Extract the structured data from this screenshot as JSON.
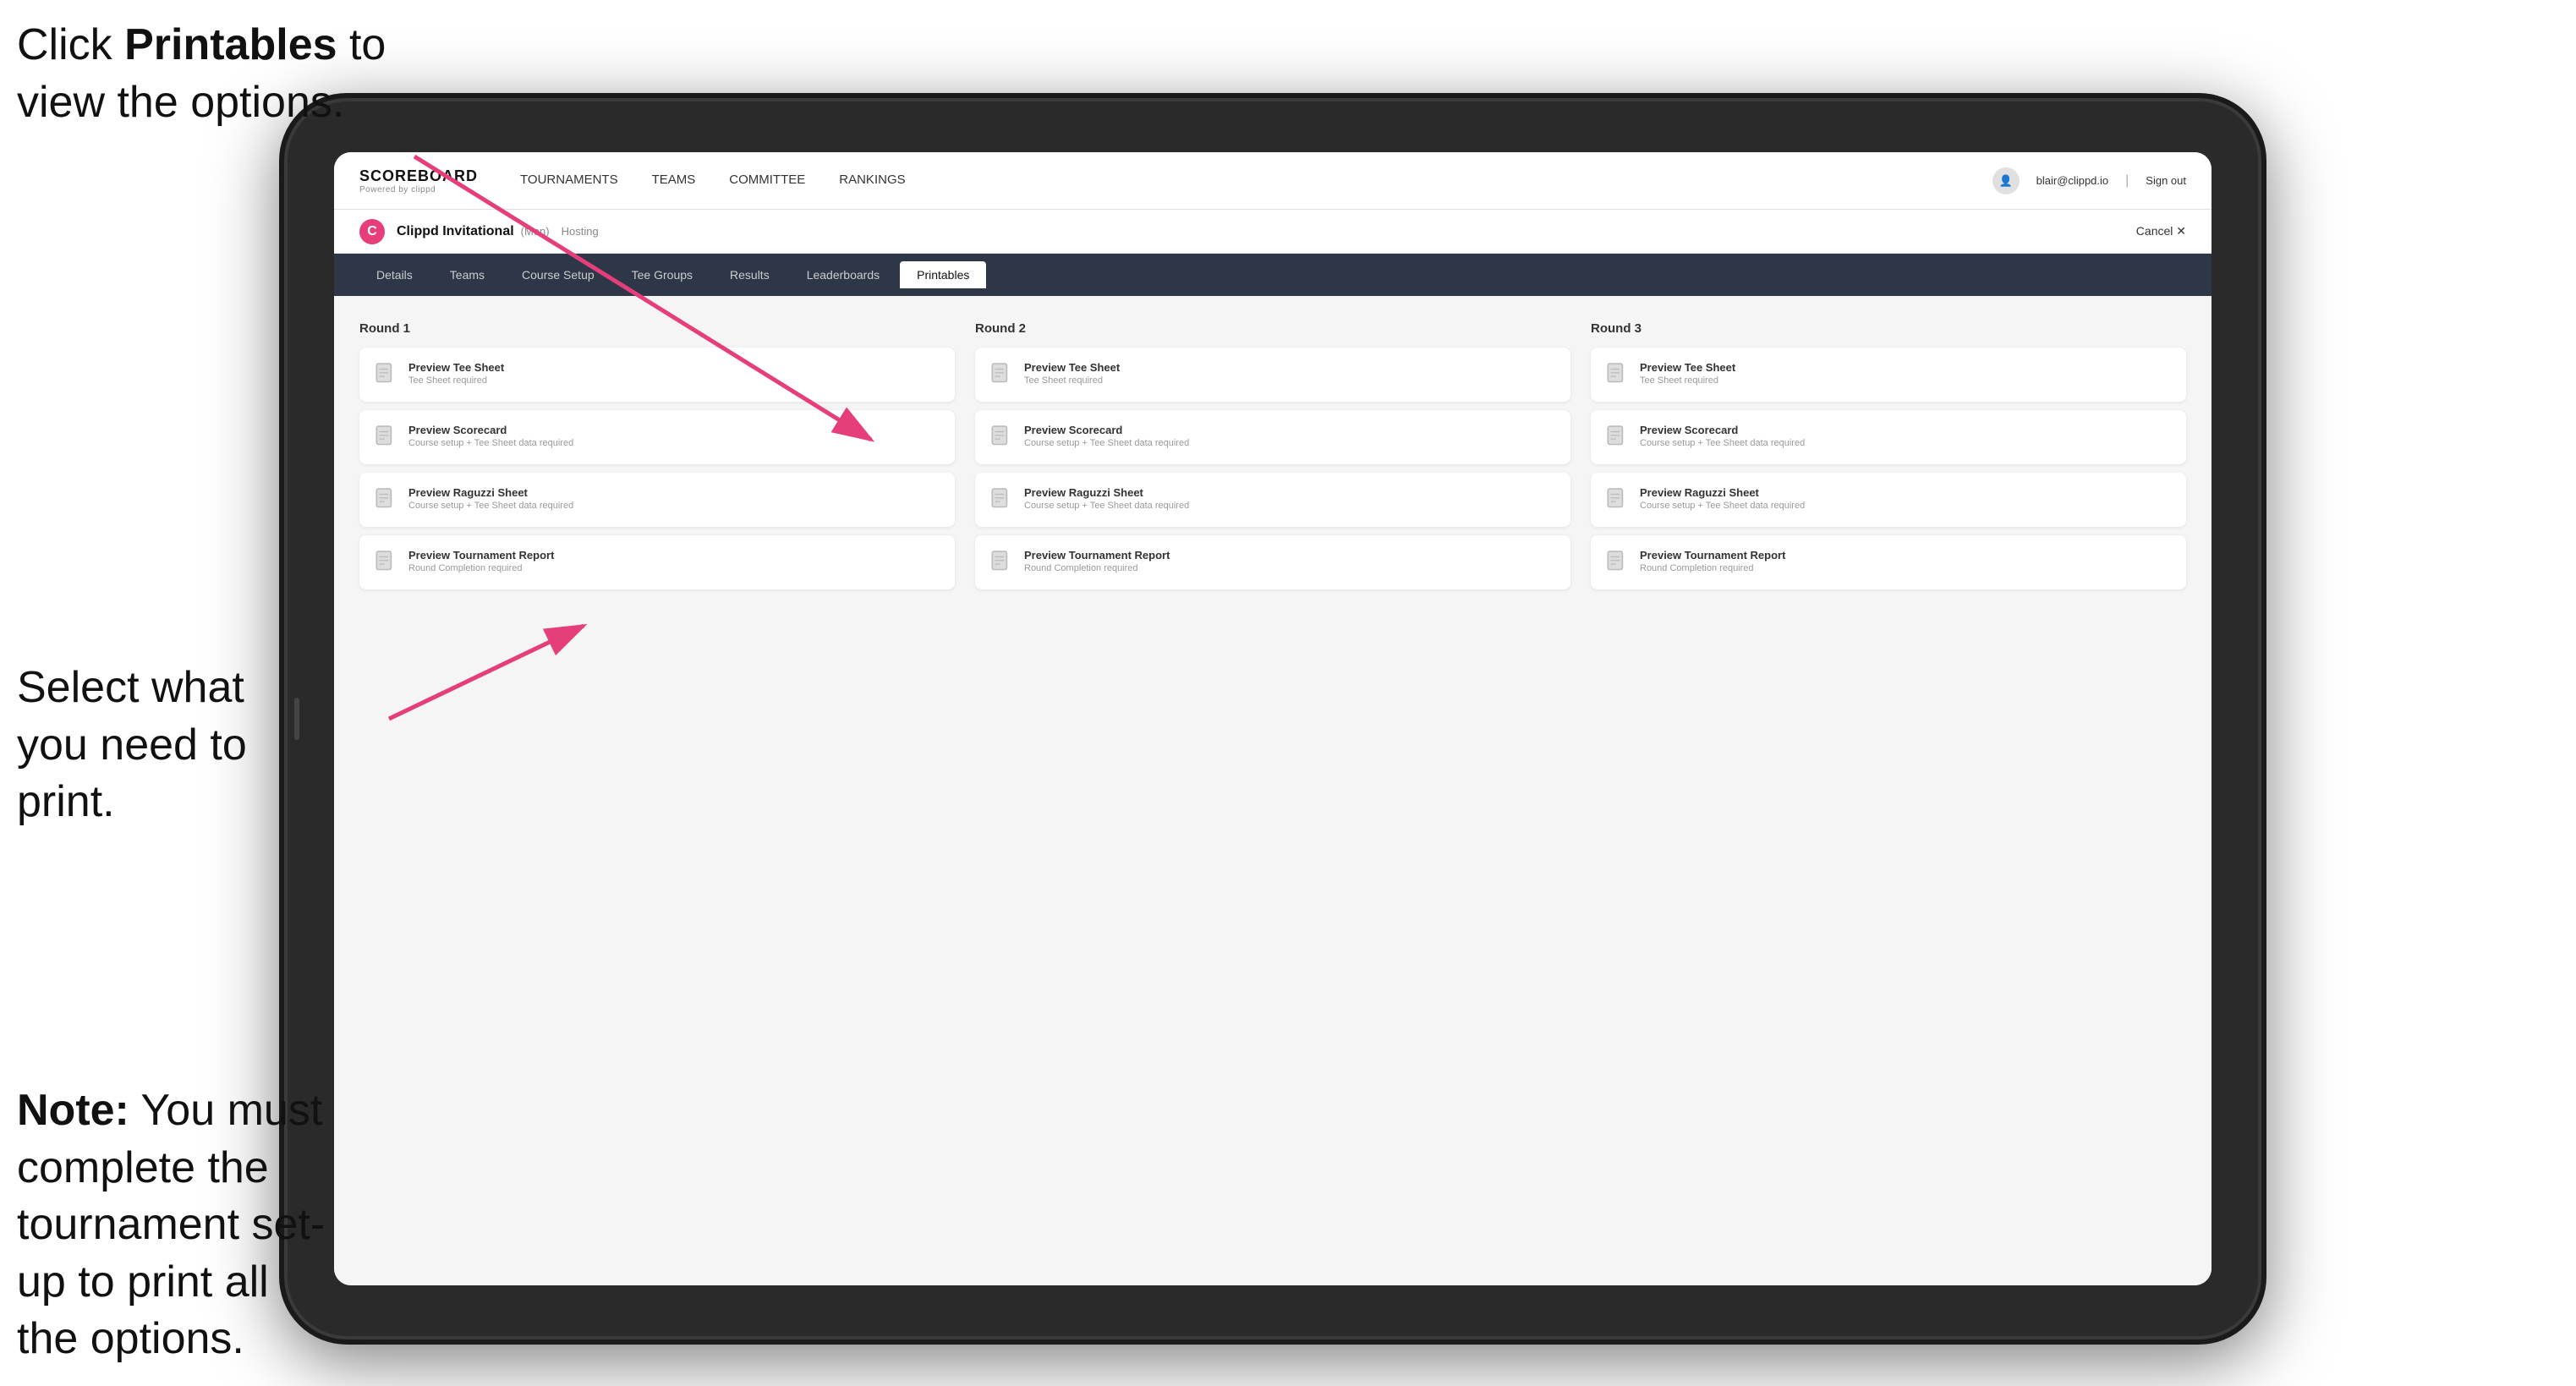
{
  "annotations": {
    "top": {
      "line1": "Click ",
      "bold": "Printables",
      "line2": " to",
      "line3": "view the options."
    },
    "middle": {
      "text": "Select what you need to print."
    },
    "bottom": {
      "bold": "Note:",
      "text": " You must complete the tournament set-up to print all the options."
    }
  },
  "topNav": {
    "logoTitle": "SCOREBOARD",
    "logoSub": "Powered by clippd",
    "links": [
      {
        "label": "TOURNAMENTS",
        "active": false
      },
      {
        "label": "TEAMS",
        "active": false
      },
      {
        "label": "COMMITTEE",
        "active": false
      },
      {
        "label": "RANKINGS",
        "active": false
      }
    ],
    "userEmail": "blair@clippd.io",
    "signOut": "Sign out"
  },
  "subHeader": {
    "logoChar": "C",
    "tournamentName": "Clippd Invitational",
    "division": "(Men)",
    "status": "Hosting",
    "cancel": "Cancel ✕"
  },
  "tabs": [
    {
      "label": "Details",
      "active": false
    },
    {
      "label": "Teams",
      "active": false
    },
    {
      "label": "Course Setup",
      "active": false
    },
    {
      "label": "Tee Groups",
      "active": false
    },
    {
      "label": "Results",
      "active": false
    },
    {
      "label": "Leaderboards",
      "active": false
    },
    {
      "label": "Printables",
      "active": true
    }
  ],
  "rounds": [
    {
      "title": "Round 1",
      "cards": [
        {
          "title": "Preview Tee Sheet",
          "sub": "Tee Sheet required"
        },
        {
          "title": "Preview Scorecard",
          "sub": "Course setup + Tee Sheet data required"
        },
        {
          "title": "Preview Raguzzi Sheet",
          "sub": "Course setup + Tee Sheet data required"
        },
        {
          "title": "Preview Tournament Report",
          "sub": "Round Completion required"
        }
      ]
    },
    {
      "title": "Round 2",
      "cards": [
        {
          "title": "Preview Tee Sheet",
          "sub": "Tee Sheet required"
        },
        {
          "title": "Preview Scorecard",
          "sub": "Course setup + Tee Sheet data required"
        },
        {
          "title": "Preview Raguzzi Sheet",
          "sub": "Course setup + Tee Sheet data required"
        },
        {
          "title": "Preview Tournament Report",
          "sub": "Round Completion required"
        }
      ]
    },
    {
      "title": "Round 3",
      "cards": [
        {
          "title": "Preview Tee Sheet",
          "sub": "Tee Sheet required"
        },
        {
          "title": "Preview Scorecard",
          "sub": "Course setup + Tee Sheet data required"
        },
        {
          "title": "Preview Raguzzi Sheet",
          "sub": "Course setup + Tee Sheet data required"
        },
        {
          "title": "Preview Tournament Report",
          "sub": "Round Completion required"
        }
      ]
    }
  ]
}
